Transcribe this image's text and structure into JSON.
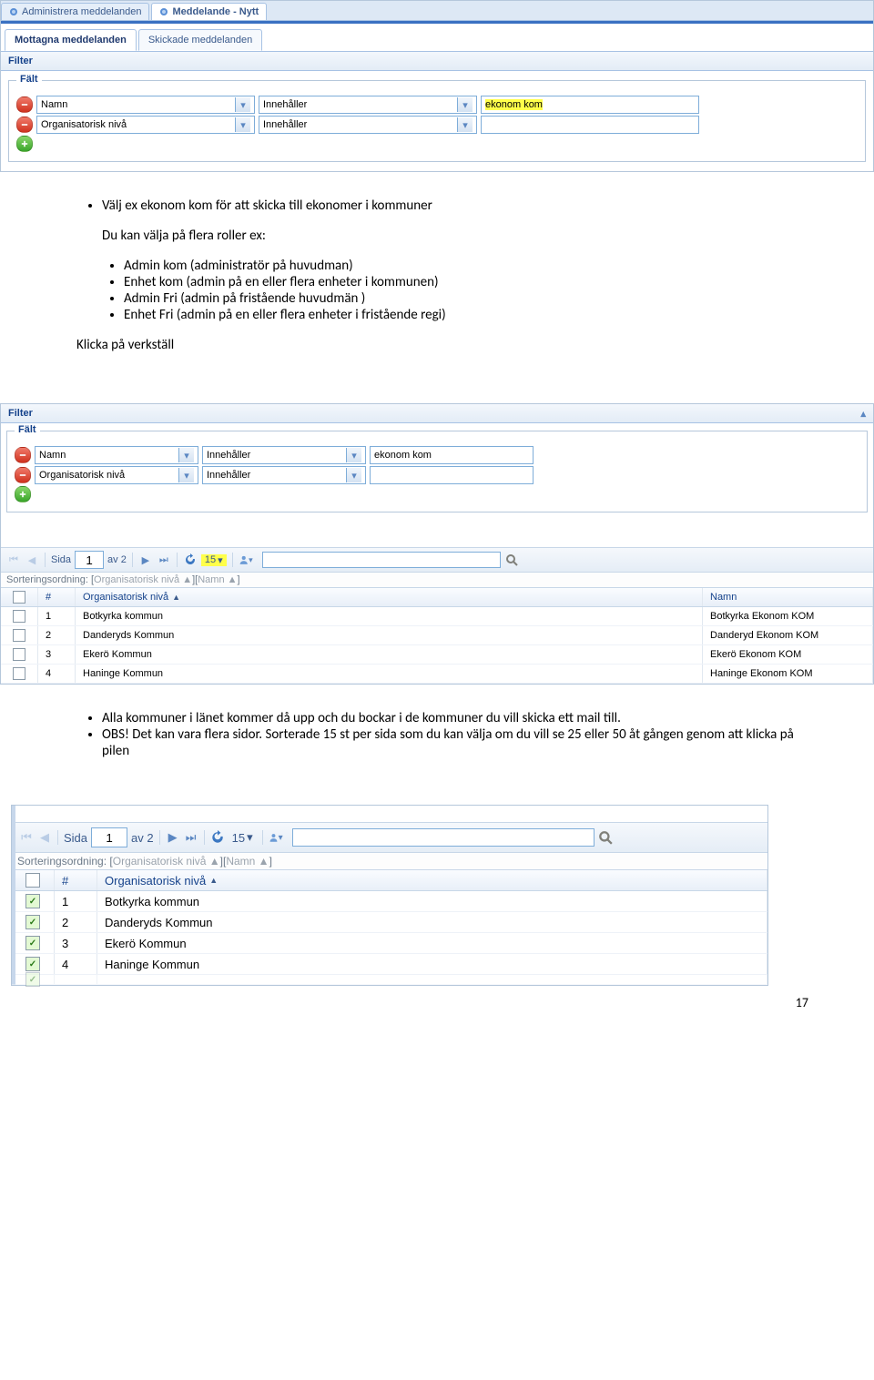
{
  "shot1": {
    "tabs": [
      {
        "label": "Administrera meddelanden",
        "active": false
      },
      {
        "label": "Meddelande - Nytt",
        "active": true
      }
    ],
    "subtabs": [
      {
        "label": "Mottagna meddelanden",
        "active": true
      },
      {
        "label": "Skickade meddelanden",
        "active": false
      }
    ],
    "filter_title": "Filter",
    "fieldset_legend": "Fält",
    "rows": [
      {
        "field": "Namn",
        "op": "Innehåller",
        "value": "ekonom kom",
        "highlighted": true
      },
      {
        "field": "Organisatorisk nivå",
        "op": "Innehåller",
        "value": "",
        "highlighted": false
      }
    ]
  },
  "body1": {
    "p1": "Välj ex ekonom kom för att skicka till ekonomer i kommuner",
    "p2": "Du kan välja på flera roller ex:",
    "items": [
      "Admin kom (administratör på huvudman)",
      "Enhet kom (admin på en eller flera enheter i kommunen)",
      "Admin Fri (admin på fristående huvudmän )",
      "Enhet Fri (admin på en eller flera enheter i fristående regi)"
    ],
    "p3": "Klicka på verkställ"
  },
  "shot2": {
    "filter_title": "Filter",
    "chev": "▴",
    "fieldset_legend": "Fält",
    "rows": [
      {
        "field": "Namn",
        "op": "Innehåller",
        "value": "ekonom kom"
      },
      {
        "field": "Organisatorisk nivå",
        "op": "Innehåller",
        "value": ""
      }
    ],
    "pager": {
      "label_page": "Sida",
      "page": "1",
      "of_label": "av 2",
      "perpage": "15",
      "perpage_hl": true
    },
    "sortline_label": "Sorteringsordning:",
    "sort_chips": [
      "Organisatorisk nivå ▲",
      "Namn ▲"
    ],
    "headers": {
      "hash": "#",
      "org": "Organisatorisk nivå",
      "name": "Namn"
    },
    "sort_indicator": "▲",
    "rows_data": [
      {
        "n": "1",
        "org": "Botkyrka kommun",
        "name": "Botkyrka Ekonom KOM"
      },
      {
        "n": "2",
        "org": "Danderyds Kommun",
        "name": "Danderyd Ekonom KOM"
      },
      {
        "n": "3",
        "org": "Ekerö Kommun",
        "name": "Ekerö Ekonom KOM"
      },
      {
        "n": "4",
        "org": "Haninge Kommun",
        "name": "Haninge Ekonom KOM"
      }
    ]
  },
  "body2": {
    "items": [
      "Alla kommuner i länet kommer då upp och du bockar i de kommuner du vill skicka ett mail till.",
      " OBS! Det kan vara flera sidor.",
      "Sorterade 15 st per sida som du kan välja om du vill se 25 eller 50 åt gången genom att klicka på pilen"
    ]
  },
  "shot3": {
    "pager": {
      "label_page": "Sida",
      "page": "1",
      "of_label": "av 2",
      "perpage": "15"
    },
    "sortline_label": "Sorteringsordning:",
    "sort_chips": [
      "Organisatorisk nivå ▲",
      "Namn ▲"
    ],
    "headers": {
      "hash": "#",
      "org": "Organisatorisk nivå"
    },
    "sort_indicator": "▲",
    "rows_data": [
      {
        "n": "1",
        "org": "Botkyrka kommun",
        "checked": true
      },
      {
        "n": "2",
        "org": "Danderyds Kommun",
        "checked": true
      },
      {
        "n": "3",
        "org": "Ekerö Kommun",
        "checked": true
      },
      {
        "n": "4",
        "org": "Haninge Kommun",
        "checked": true
      }
    ]
  },
  "page_number": "17"
}
